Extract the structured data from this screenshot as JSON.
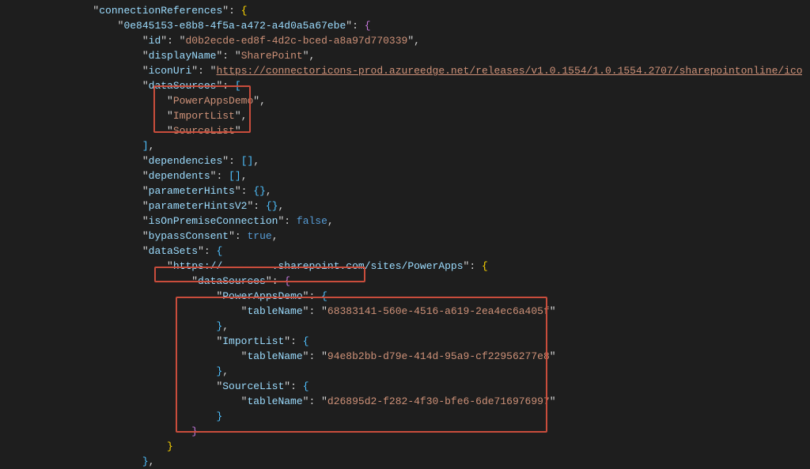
{
  "connectionReferences_key": "connectionReferences",
  "connRef_id_key": "0e845153-e8b8-4f5a-a472-a4d0a5a67ebe",
  "id_key": "id",
  "id_val": "d0b2ecde-ed8f-4d2c-bced-a8a97d770339",
  "displayName_key": "displayName",
  "displayName_val": "SharePoint",
  "iconUri_key": "iconUri",
  "iconUri_val": "https://connectoricons-prod.azureedge.net/releases/v1.0.1554/1.0.1554.2707/sharepointonline/icon.png",
  "dataSources_key": "dataSources",
  "ds1": "PowerAppsDemo",
  "ds2": "ImportList",
  "ds3": "SourceList",
  "dependencies_key": "dependencies",
  "dependents_key": "dependents",
  "parameterHints_key": "parameterHints",
  "parameterHintsV2_key": "parameterHintsV2",
  "isOnPremise_key": "isOnPremiseConnection",
  "isOnPremise_val": "false",
  "bypassConsent_key": "bypassConsent",
  "bypassConsent_val": "true",
  "dataSets_key": "dataSets",
  "site_url_p1": "https://",
  "site_url_p2": ".sharepoint.com/sites/PowerApps",
  "dataSources2_key": "dataSources",
  "pa_key": "PowerAppsDemo",
  "tn_key": "tableName",
  "pa_tn": "68383141-560e-4516-a619-2ea4ec6a405f",
  "il_key": "ImportList",
  "il_tn": "94e8b2bb-d79e-414d-95a9-cf22956277e8",
  "sl_key": "SourceList",
  "sl_tn": "d26895d2-f282-4f30-bfe6-6de716976997"
}
